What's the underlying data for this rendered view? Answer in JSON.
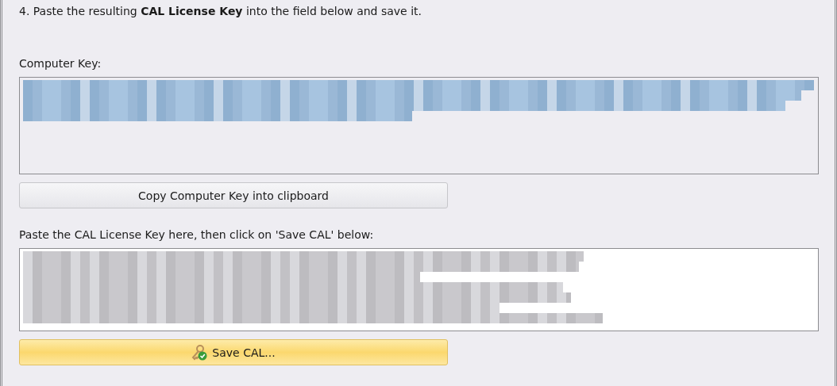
{
  "step": "4. Paste the resulting **CAL License Key** into the field below and save it.",
  "computer_key": {
    "label": "Computer Key:",
    "read_only": true,
    "selected": true
  },
  "copy_button": {
    "label": "Copy Computer Key into clipboard",
    "highlighted": false
  },
  "license_key": {
    "label": "Paste the CAL License Key here, then click on 'Save CAL' below:",
    "read_only": false,
    "selected": false
  },
  "save_button": {
    "label": "Save CAL...",
    "highlighted": true
  }
}
